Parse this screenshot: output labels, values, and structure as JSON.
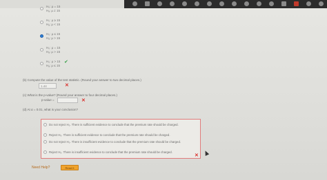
{
  "hypotheses": [
    {
      "l1": "H₀: μ = 15",
      "l2": "Hₐ: μ ≠ 15",
      "selected": false
    },
    {
      "l1": "H₀: μ ≥ 15",
      "l2": "Hₐ: μ < 15",
      "selected": false
    },
    {
      "l1": "H₀: μ ≤ 15",
      "l2": "Hₐ: μ > 15",
      "selected": true
    },
    {
      "l1": "H₀: μ = 15",
      "l2": "Hₐ: μ > 15",
      "selected": false
    },
    {
      "l1": "H₀: μ > 15",
      "l2": "Hₐ: μ ≤ 15",
      "selected": false
    }
  ],
  "part_b": {
    "question": "(b)   Compute the value of the test statistic. (Round your answer to two decimal places.)",
    "answer": "1.44"
  },
  "part_c": {
    "question": "(c)   What is the p-value? (Round your answer to four decimal places.)",
    "label": "p-value =",
    "answer": ""
  },
  "part_d": {
    "question": "(d)   At α = 0.01, what is your conclusion?",
    "options": [
      "Do not reject H₀. There is sufficient evidence to conclude that the premium rate should be charged.",
      "Reject H₀. There is sufficient evidence to conclude that the premium rate should be charged.",
      "Do not reject H₀. There is insufficient evidence to conclude that the premium rate should be charged.",
      "Reject H₀. There is insufficient evidence to conclude that the premium rate should be charged."
    ]
  },
  "footer": {
    "need_help": "Need Help?",
    "read_it": "Read It"
  },
  "marks": {
    "wrong": "✕",
    "correct": "✔"
  }
}
